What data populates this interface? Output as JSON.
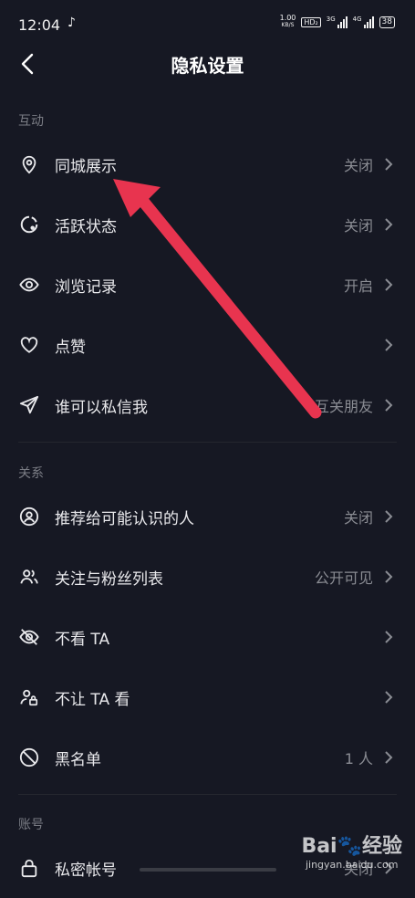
{
  "status": {
    "time": "12:04",
    "net_speed_value": "1.00",
    "net_speed_unit": "KB/S",
    "hd_badge": "HD₂",
    "sig1_label": "3G",
    "sig2_label": "4G",
    "battery": "38"
  },
  "header": {
    "title": "隐私设置"
  },
  "sections": {
    "interaction": "互动",
    "relations": "关系",
    "account": "账号"
  },
  "rows": {
    "nearby": {
      "label": "同城展示",
      "value": "关闭",
      "icon": "location-pin-icon"
    },
    "active": {
      "label": "活跃状态",
      "value": "关闭",
      "icon": "active-status-icon"
    },
    "history": {
      "label": "浏览记录",
      "value": "开启",
      "icon": "eye-icon"
    },
    "likes": {
      "label": "点赞",
      "value": "",
      "icon": "heart-icon"
    },
    "dm": {
      "label": "谁可以私信我",
      "value": "互关朋友",
      "icon": "send-icon"
    },
    "recommend": {
      "label": "推荐给可能认识的人",
      "value": "关闭",
      "icon": "user-circle-icon"
    },
    "follow_list": {
      "label": "关注与粉丝列表",
      "value": "公开可见",
      "icon": "users-icon"
    },
    "hide_ta": {
      "label": "不看 TA",
      "value": "",
      "icon": "eye-off-icon"
    },
    "block_ta": {
      "label": "不让 TA 看",
      "value": "",
      "icon": "user-lock-icon"
    },
    "blacklist": {
      "label": "黑名单",
      "value": "1 人",
      "icon": "ban-icon"
    },
    "private_account": {
      "label": "私密帐号",
      "value": "关闭",
      "icon": "lock-icon"
    }
  },
  "watermark": {
    "logo": "Bai🐾经验",
    "url": "jingyan.baidu.com"
  },
  "colors": {
    "background": "#161823",
    "annotation_arrow": "#e8344f",
    "text_secondary": "#8a8c93"
  }
}
